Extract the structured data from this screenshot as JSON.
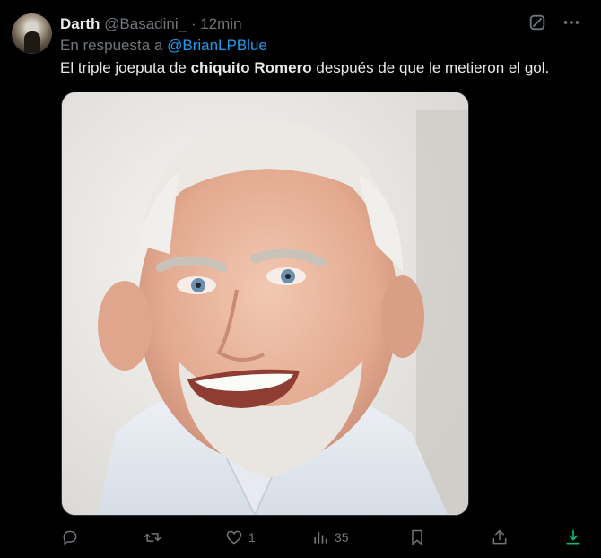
{
  "tweet": {
    "display_name": "Darth",
    "handle": "@Basadini_",
    "separator": "·",
    "time": "12min",
    "reply_prefix": "En respuesta a",
    "reply_to": "@BrianLPBlue",
    "text_before": "El triple joeputa de",
    "text_bold": "chiquito Romero",
    "text_after": "después de que le metieron el gol.",
    "media_image": "smiling-older-man-photo"
  },
  "actions": {
    "reply_count": "",
    "retweet_count": "",
    "like_count": "1",
    "views_count": "35"
  },
  "colors": {
    "background": "#000000",
    "text": "#e7e9ea",
    "muted": "#71767b",
    "link": "#1d9bf0",
    "download_accent": "#00ba7c"
  },
  "icons": [
    "grok-icon",
    "more-icon",
    "reply-icon",
    "retweet-icon",
    "like-icon",
    "views-icon",
    "bookmark-icon",
    "share-icon",
    "download-icon"
  ]
}
